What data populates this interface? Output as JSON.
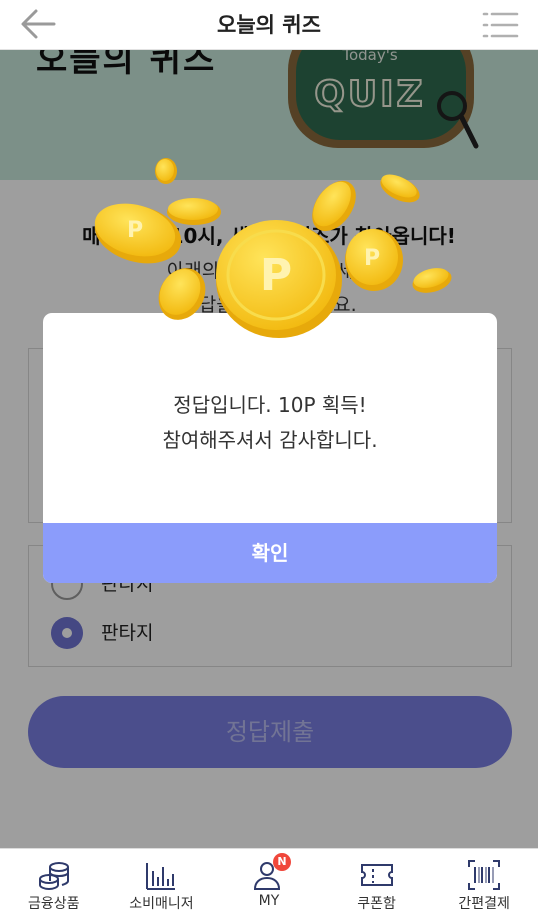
{
  "header": {
    "title": "오늘의 퀴즈",
    "back_icon": "arrow-left-icon",
    "menu_icon": "list-menu-icon"
  },
  "banner": {
    "title": "오늘의 퀴즈",
    "board_small": "Today's",
    "board_big": "QUIZ"
  },
  "quiz": {
    "line1": "매일 오전 10시, 새로운 퀴즈가 찾아옵니다!",
    "line2": "아래의 질문을 확인하세요",
    "line3": "정답을 선택해 주세요.",
    "options": [
      {
        "label": "판타지",
        "selected": false
      },
      {
        "label": "판타지",
        "selected": true
      }
    ],
    "submit_label": "정답제출"
  },
  "modal": {
    "message_line1": "정답입니다. 10P 획득!",
    "message_line2": "참여해주셔서 감사합니다.",
    "confirm_label": "확인"
  },
  "coin_letter": "P",
  "bottom_nav": {
    "items": [
      {
        "label": "금융상품",
        "icon": "coins-stack-icon"
      },
      {
        "label": "소비매니저",
        "icon": "bar-chart-icon"
      },
      {
        "label": "MY",
        "icon": "user-icon",
        "badge": "N"
      },
      {
        "label": "쿠폰함",
        "icon": "ticket-icon"
      },
      {
        "label": "간편결제",
        "icon": "barcode-icon"
      }
    ]
  },
  "colors": {
    "accent": "#8b9cfb",
    "submit": "#7a7fe2",
    "badge": "#f0473b",
    "banner": "#c9e8dc",
    "coin": "#f7c91c"
  }
}
